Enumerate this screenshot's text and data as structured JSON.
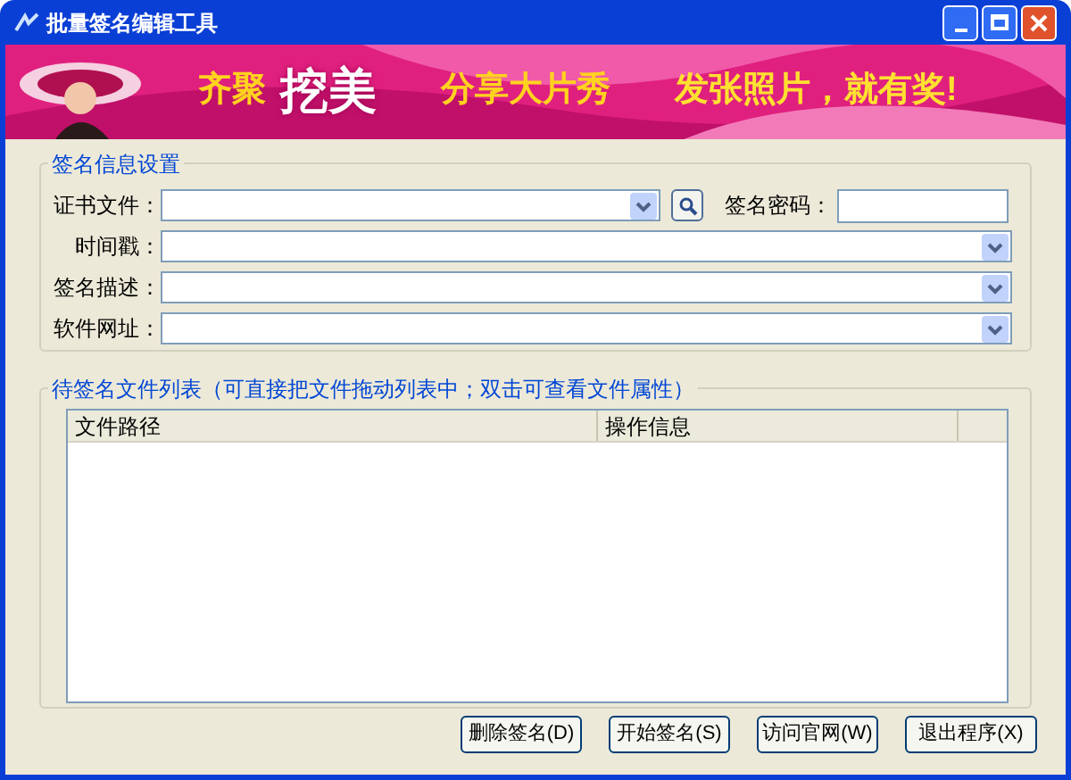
{
  "window": {
    "title": "批量签名编辑工具"
  },
  "banner": {
    "kind": "picture",
    "slogans": [
      "齐聚",
      "挖美",
      "分享大片秀",
      "发张照片，就有奖!"
    ]
  },
  "settings": {
    "title": "签名信息设置",
    "rows": [
      {
        "label": "证书文件：",
        "value": ""
      },
      {
        "label": "时间戳：",
        "value": ""
      },
      {
        "label": "签名描述：",
        "value": ""
      },
      {
        "label": "软件网址：",
        "value": ""
      }
    ],
    "password_label": "签名密码："
  },
  "file_list": {
    "title": "待签名文件列表（可直接把文件拖动列表中；双击可查看文件属性）",
    "columns": [
      "文件路径",
      "操作信息"
    ]
  },
  "buttons": [
    "删除签名(D)",
    "开始签名(S)",
    "访问官网(W)",
    "退出程序(X)"
  ]
}
